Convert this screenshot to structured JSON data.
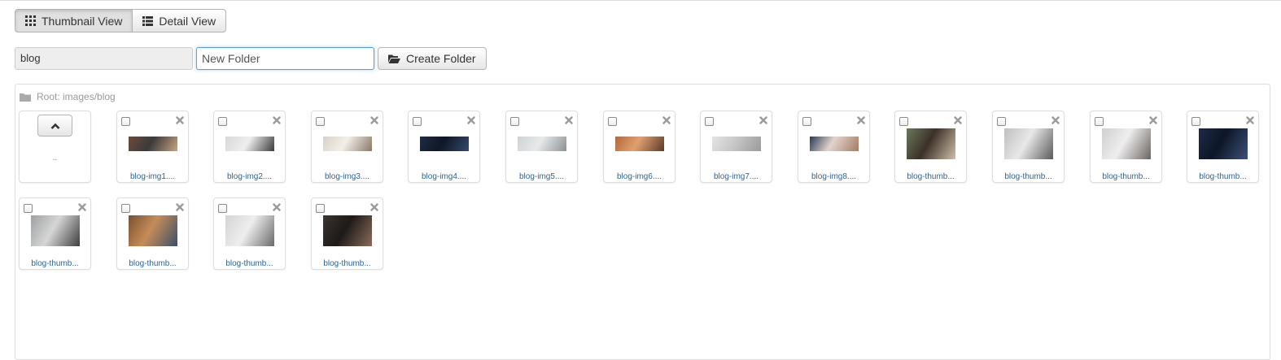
{
  "view_toggle": {
    "thumbnail_label": "Thumbnail View",
    "detail_label": "Detail View"
  },
  "path_field": {
    "value": "blog"
  },
  "new_folder": {
    "value": "New Folder"
  },
  "create_folder": {
    "label": "Create Folder"
  },
  "breadcrumb": {
    "text": "Root: images/blog"
  },
  "parent": {
    "label": ".."
  },
  "files": [
    {
      "name": "blog-img1....",
      "colors": [
        "#6b4c3b",
        "#c9a27f",
        "#3a3a3a"
      ]
    },
    {
      "name": "blog-img2....",
      "colors": [
        "#d8d8d8",
        "#3b3b3b",
        "#eeeeee"
      ]
    },
    {
      "name": "blog-img3....",
      "colors": [
        "#d9d2c6",
        "#8a7a66",
        "#f2efe9"
      ]
    },
    {
      "name": "blog-img4....",
      "colors": [
        "#1f2c44",
        "#34496b",
        "#0f1726"
      ]
    },
    {
      "name": "blog-img5....",
      "colors": [
        "#cfd2d4",
        "#8c9194",
        "#e7e9ea"
      ]
    },
    {
      "name": "blog-img6....",
      "colors": [
        "#b4683a",
        "#5a3a2a",
        "#e0a070"
      ]
    },
    {
      "name": "blog-img7....",
      "colors": [
        "#e4e4e4",
        "#9a9a9a",
        "#c7c7c7"
      ]
    },
    {
      "name": "blog-img8....",
      "colors": [
        "#2c3a55",
        "#a37b66",
        "#e2d4cc"
      ]
    },
    {
      "name": "blog-thumb...",
      "colors": [
        "#6a7a5a",
        "#d0c0a8",
        "#3c3028"
      ]
    },
    {
      "name": "blog-thumb...",
      "colors": [
        "#bfbfbf",
        "#5a5a5a",
        "#e8e8e8"
      ]
    },
    {
      "name": "blog-thumb...",
      "colors": [
        "#cfcfcf",
        "#6b6460",
        "#eeeeee"
      ]
    },
    {
      "name": "blog-thumb...",
      "colors": [
        "#1c2b45",
        "#3b5278",
        "#0e1628"
      ]
    },
    {
      "name": "blog-thumb...",
      "colors": [
        "#9da0a2",
        "#3e3e3e",
        "#d6d6d6"
      ]
    },
    {
      "name": "blog-thumb...",
      "colors": [
        "#7a5030",
        "#3a5068",
        "#c58c58"
      ]
    },
    {
      "name": "blog-thumb...",
      "colors": [
        "#d4d4d4",
        "#6a6a6a",
        "#eeeeee"
      ]
    },
    {
      "name": "blog-thumb...",
      "colors": [
        "#3c3430",
        "#8a6c5a",
        "#1e1a18"
      ]
    }
  ]
}
